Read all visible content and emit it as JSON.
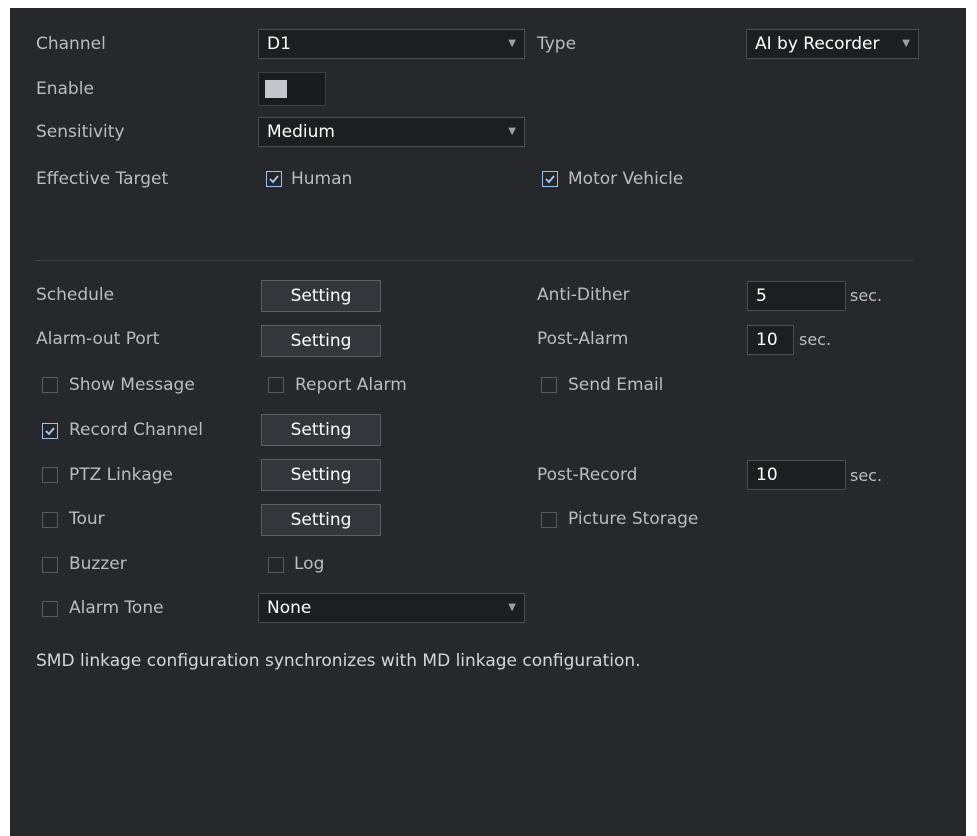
{
  "channel": {
    "label": "Channel",
    "value": "D1"
  },
  "type": {
    "label": "Type",
    "value": "AI by Recorder"
  },
  "enable": {
    "label": "Enable",
    "on": true
  },
  "sensitivity": {
    "label": "Sensitivity",
    "value": "Medium"
  },
  "effective_target": {
    "label": "Effective Target",
    "human": {
      "label": "Human",
      "checked": true
    },
    "motor_vehicle": {
      "label": "Motor Vehicle",
      "checked": true
    }
  },
  "schedule": {
    "label": "Schedule",
    "button": "Setting"
  },
  "anti_dither": {
    "label": "Anti-Dither",
    "value": "5",
    "unit": "sec."
  },
  "alarm_out_port": {
    "label": "Alarm-out Port",
    "button": "Setting"
  },
  "post_alarm": {
    "label": "Post-Alarm",
    "value": "10",
    "unit": "sec."
  },
  "show_message": {
    "label": "Show Message",
    "checked": false
  },
  "report_alarm": {
    "label": "Report Alarm",
    "checked": false
  },
  "send_email": {
    "label": "Send Email",
    "checked": false
  },
  "record_channel": {
    "label": "Record Channel",
    "checked": true,
    "button": "Setting"
  },
  "ptz_linkage": {
    "label": "PTZ Linkage",
    "checked": false,
    "button": "Setting"
  },
  "post_record": {
    "label": "Post-Record",
    "value": "10",
    "unit": "sec."
  },
  "tour": {
    "label": "Tour",
    "checked": false,
    "button": "Setting"
  },
  "picture_storage": {
    "label": "Picture Storage",
    "checked": false
  },
  "buzzer": {
    "label": "Buzzer",
    "checked": false
  },
  "log": {
    "label": "Log",
    "checked": false
  },
  "alarm_tone": {
    "label": "Alarm Tone",
    "checked": false,
    "value": "None"
  },
  "note": "SMD linkage configuration synchronizes with MD linkage configuration.",
  "icons": {
    "dropdown": "chevron-down-icon",
    "check": "check-icon"
  },
  "colors": {
    "background": "#27282c",
    "accent_check": "#9fc3e8",
    "field_bg": "#1d1e21"
  }
}
